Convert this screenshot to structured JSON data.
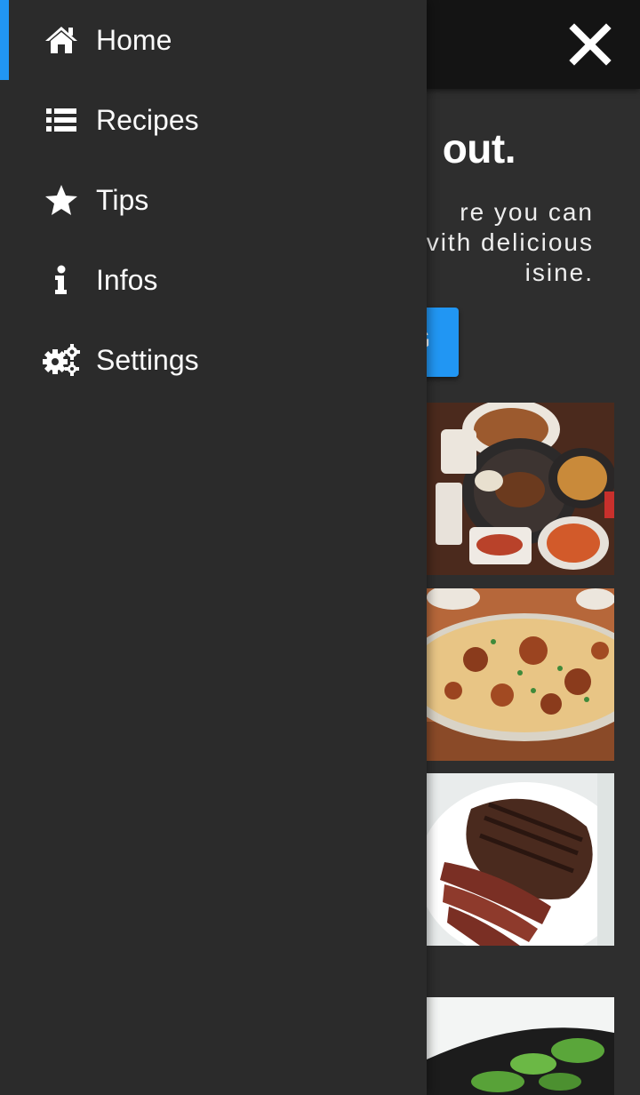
{
  "header": {
    "close_icon": "close-icon"
  },
  "hero": {
    "heading": "out.",
    "text_lines": [
      "re you can",
      "vith delicious",
      "isine."
    ],
    "button_label": "G"
  },
  "food_cards": [
    {
      "icon": "korean-bbq-image"
    },
    {
      "icon": "biryani-image"
    },
    {
      "icon": "grilled-steak-image"
    },
    {
      "icon": "salad-bowl-image"
    }
  ],
  "drawer": {
    "items": [
      {
        "label": "Home",
        "icon": "home-icon",
        "active": true
      },
      {
        "label": "Recipes",
        "icon": "list-icon",
        "active": false
      },
      {
        "label": "Tips",
        "icon": "star-icon",
        "active": false
      },
      {
        "label": "Infos",
        "icon": "info-icon",
        "active": false
      },
      {
        "label": "Settings",
        "icon": "gears-icon",
        "active": false
      }
    ]
  },
  "colors": {
    "accent": "#2196f3",
    "drawer_bg": "#2b2b2b",
    "topbar_bg": "#141414",
    "text": "#fafafa"
  }
}
